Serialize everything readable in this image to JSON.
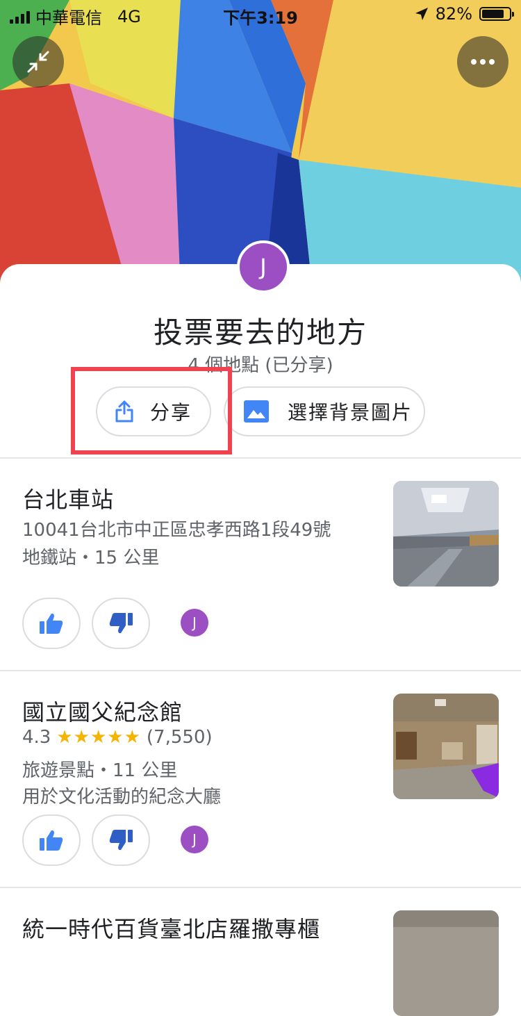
{
  "status_bar": {
    "carrier": "中華電信",
    "network": "4G",
    "time": "下午3:19",
    "battery": "82%",
    "battery_level": 0.82
  },
  "header": {
    "avatar_initial": "J",
    "list_title": "投票要去的地方",
    "list_subtitle": "4 個地點 (已分享)",
    "share_label": "分享",
    "background_label": "選擇背景圖片"
  },
  "colors": {
    "accent_blue": "#4285f4",
    "avatar_purple": "#9c4fc3",
    "star_gold": "#f4b400",
    "highlight_red": "#f0434f"
  },
  "places": [
    {
      "name": "台北車站",
      "address": "10041台北市中正區忠孝西路1段49號",
      "meta": "地鐵站・15 公里",
      "voter_initial": "J"
    },
    {
      "name": "國立國父紀念館",
      "rating": "4.3",
      "rating_value": 4.3,
      "stars": "★★★★★",
      "review_count": "(7,550)",
      "meta": "旅遊景點・11 公里",
      "description": "用於文化活動的紀念大廳",
      "voter_initial": "J"
    },
    {
      "name": "統一時代百貨臺北店羅撒專櫃"
    }
  ],
  "icons": {
    "collapse": "collapse-icon",
    "more": "more-icon",
    "share": "share-icon",
    "image": "image-icon",
    "thumbs_up": "thumbs-up-icon",
    "thumbs_down": "thumbs-down-icon"
  }
}
